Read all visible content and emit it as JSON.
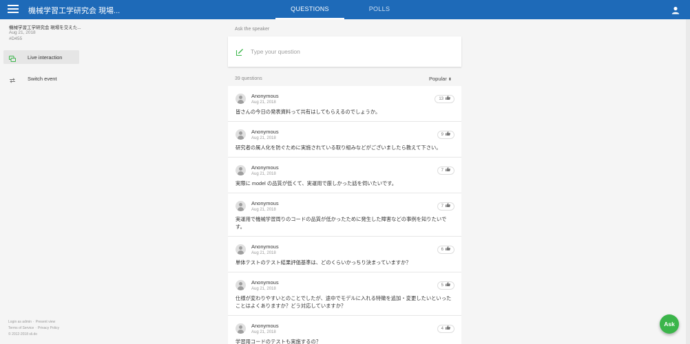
{
  "topbar": {
    "event_title": "機械学習工学研究会 現場...",
    "tabs": [
      {
        "label": "QUESTIONS",
        "active": true
      },
      {
        "label": "POLLS",
        "active": false
      }
    ],
    "menu_icon": "hamburger-menu-icon",
    "user_icon": "person-icon"
  },
  "sidebar": {
    "event_title": "機械学習工学研究会 現場を交えた...",
    "event_date": "Aug 21, 2018",
    "event_code": "#D455",
    "nav": [
      {
        "label": "Live interaction",
        "icon": "live-interaction-icon",
        "active": true
      },
      {
        "label": "Switch event",
        "icon": "switch-arrows-icon",
        "active": false
      }
    ],
    "footer": {
      "login": "Login as admin",
      "present": "Present view",
      "terms": "Terms of Service",
      "privacy": "Privacy Policy",
      "copyright": "© 2012-2018 sli.do"
    }
  },
  "ask": {
    "label": "Ask the speaker",
    "placeholder": "Type your question",
    "icon": "compose-pen-icon"
  },
  "questions_header": {
    "count": "39 questions",
    "sort": "Popular",
    "sort_icon": "sort-arrows-icon"
  },
  "questions": [
    {
      "author": "Anonymous",
      "date": "Aug 21, 2018",
      "text": "皆さんの今日の発表資料って共有はしてもらえるのでしょうか。",
      "likes": "13"
    },
    {
      "author": "Anonymous",
      "date": "Aug 21, 2018",
      "text": "研究者の属人化を防ぐために実施されている取り組みなどがございましたら教えて下さい。",
      "likes": "9"
    },
    {
      "author": "Anonymous",
      "date": "Aug 21, 2018",
      "text": "実際に model の品質が低くて、実運用で厳しかった話を伺いたいです。",
      "likes": "7"
    },
    {
      "author": "Anonymous",
      "date": "Aug 21, 2018",
      "text": "実運用で機械学習周りのコードの品質が低かったために発生した障害などの事例を知りたいです。",
      "likes": "7"
    },
    {
      "author": "Anonymous",
      "date": "Aug 21, 2018",
      "text": "単体テストのテスト結果評価基準は、どのくらいかっちり決まっていますか？",
      "likes": "6"
    },
    {
      "author": "Anonymous",
      "date": "Aug 21, 2018",
      "text": "仕様が変わりやすいとのことでしたが、途中でモデルに入れる特徴を追加・変更したいといったことはよくありますか？どう対応していますか？",
      "likes": "5"
    },
    {
      "author": "Anonymous",
      "date": "Aug 21, 2018",
      "text": "学習用コードのテストも実施するの？",
      "likes": "4"
    }
  ],
  "fab": {
    "label": "Ask"
  },
  "colors": {
    "brand": "#1e6ab8",
    "accent": "#3bb54a"
  }
}
